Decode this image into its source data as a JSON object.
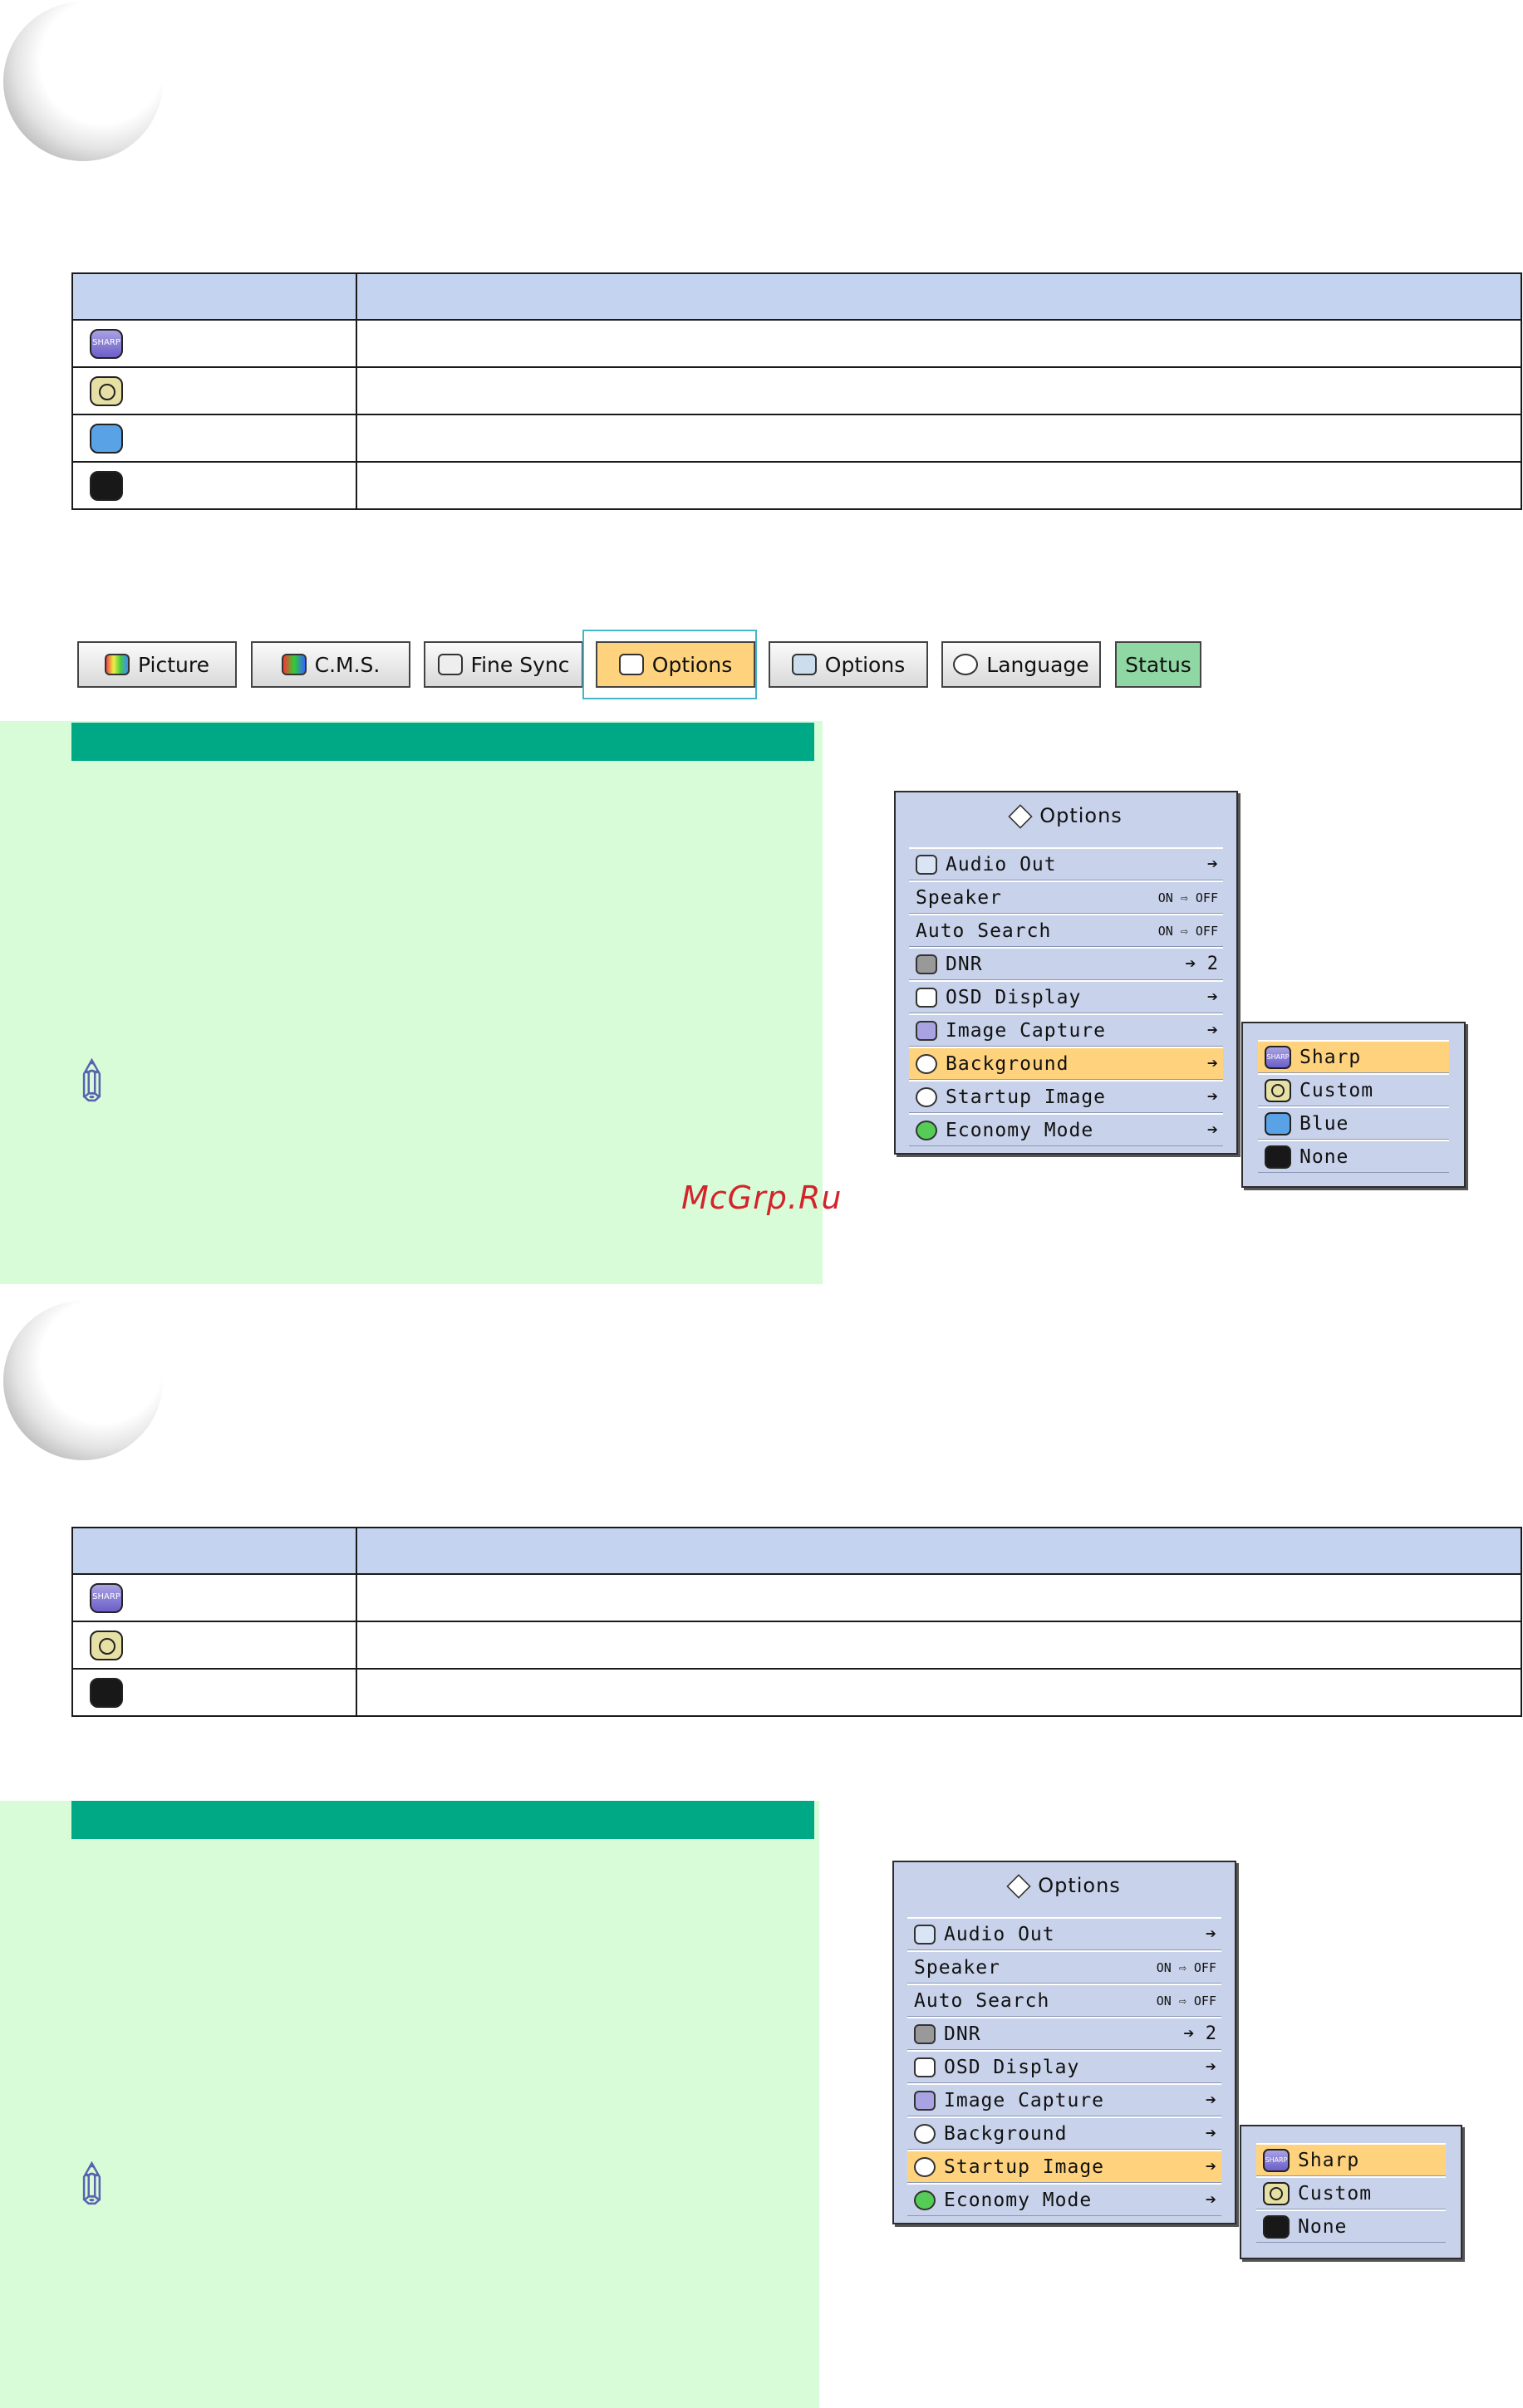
{
  "top_table": {
    "rows": [
      {
        "icon": "sharp-tile-icon"
      },
      {
        "icon": "custom-tile-icon"
      },
      {
        "icon": "blue-tile-icon"
      },
      {
        "icon": "none-tile-icon"
      }
    ]
  },
  "tabs": [
    {
      "label": "Picture",
      "icon": "picture-icon"
    },
    {
      "label": "C.M.S.",
      "icon": "cms-icon"
    },
    {
      "label": "Fine Sync",
      "icon": "fine-sync-icon"
    },
    {
      "label": "Options",
      "icon": "options-icon",
      "active": true
    },
    {
      "label": "Options",
      "icon": "options-icon"
    },
    {
      "label": "Language",
      "icon": "language-icon"
    },
    {
      "label": "Status",
      "icon": ""
    }
  ],
  "menu1": {
    "title": "Options",
    "items": [
      {
        "label": "Audio Out",
        "value": "➔"
      },
      {
        "label": "Speaker",
        "value": "ON ⇨ OFF"
      },
      {
        "label": "Auto Search",
        "value": "ON ⇨ OFF"
      },
      {
        "label": "DNR",
        "value": "➔ 2"
      },
      {
        "label": "OSD Display",
        "value": "➔"
      },
      {
        "label": "Image Capture",
        "value": "➔"
      },
      {
        "label": "Background",
        "value": "➔",
        "selected": true
      },
      {
        "label": "Startup Image",
        "value": "➔"
      },
      {
        "label": "Economy Mode",
        "value": "➔"
      }
    ],
    "submenu": [
      "Sharp",
      "Custom",
      "Blue",
      "None"
    ],
    "submenu_selected": "Sharp"
  },
  "bottom_table": {
    "rows": [
      {
        "icon": "sharp-tile-icon"
      },
      {
        "icon": "custom-tile-icon"
      },
      {
        "icon": "none-tile-icon"
      }
    ]
  },
  "menu2": {
    "title": "Options",
    "items": [
      {
        "label": "Audio Out",
        "value": "➔"
      },
      {
        "label": "Speaker",
        "value": "ON ⇨ OFF"
      },
      {
        "label": "Auto Search",
        "value": "ON ⇨ OFF"
      },
      {
        "label": "DNR",
        "value": "➔ 2"
      },
      {
        "label": "OSD Display",
        "value": "➔"
      },
      {
        "label": "Image Capture",
        "value": "➔"
      },
      {
        "label": "Background",
        "value": "➔"
      },
      {
        "label": "Startup Image",
        "value": "➔",
        "selected": true
      },
      {
        "label": "Economy Mode",
        "value": "➔"
      }
    ],
    "submenu": [
      "Sharp",
      "Custom",
      "None"
    ],
    "submenu_selected": "Sharp"
  },
  "watermark": "McGrp.Ru",
  "colors": {
    "table_header": "#c4d3ef",
    "green_panel": "#d8fcd8",
    "green_bar": "#00a986",
    "highlight": "#ffd37e",
    "osd_bg": "#c8d2ea"
  }
}
